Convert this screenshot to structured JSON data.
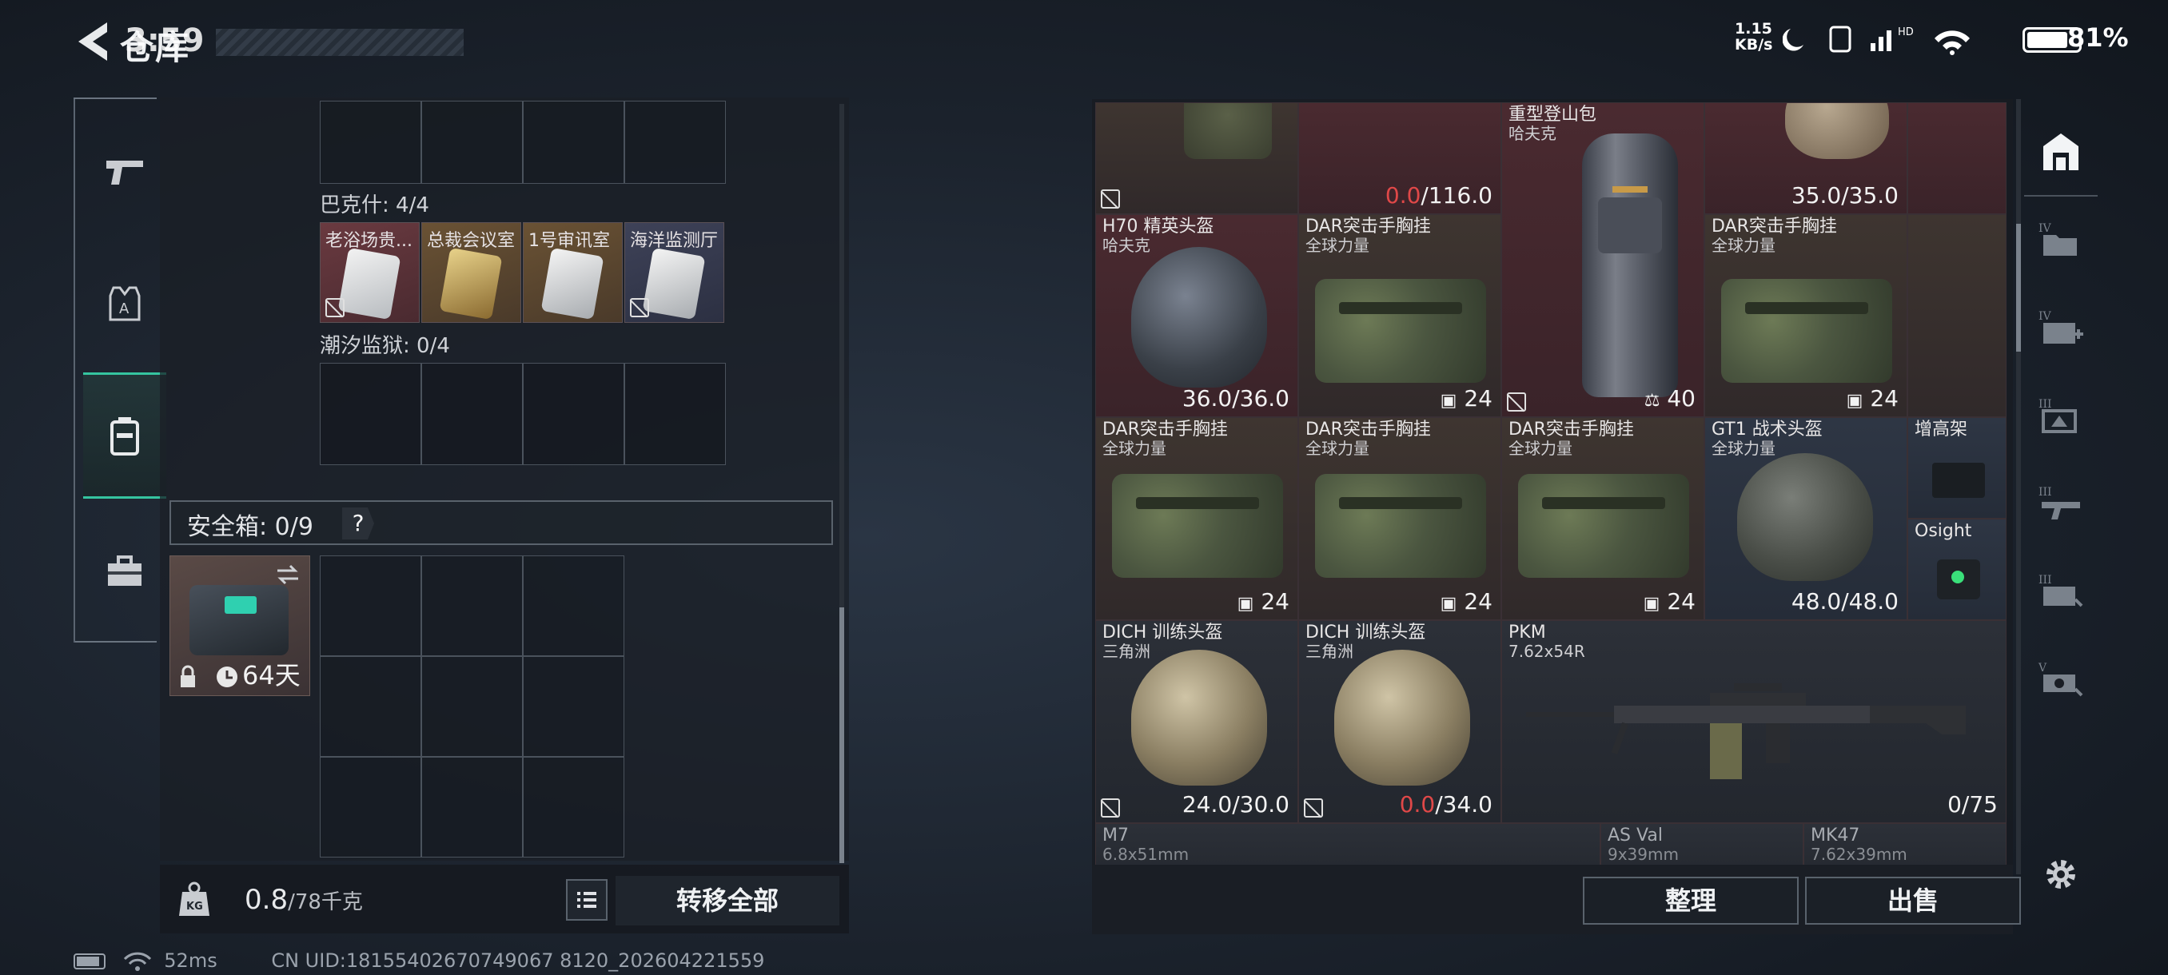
{
  "status": {
    "clock": "3:59",
    "net_speed": "1.15\nKB/s",
    "battery_text": "81%",
    "battery_level": 0.81
  },
  "header": {
    "title": "仓库"
  },
  "left_nav": {
    "items": [
      {
        "icon": "gun-icon"
      },
      {
        "icon": "armor-icon"
      },
      {
        "icon": "backpack-icon",
        "active": true
      },
      {
        "icon": "toolbox-icon"
      }
    ]
  },
  "keychain": {
    "bakshi_label": "巴克什: 4/4",
    "keys": [
      {
        "name": "老浴场贵..."
      },
      {
        "name": "总裁会议室"
      },
      {
        "name": "1号审讯室"
      },
      {
        "name": "海洋监测厅"
      }
    ],
    "tide_label": "潮汐监狱: 0/4"
  },
  "safe_box": {
    "label": "安全箱: 0/9",
    "help": "?",
    "item_time": "64天"
  },
  "bottom_left": {
    "weight": "0.8",
    "weight_max": "/78千克",
    "transfer_all": "转移全部"
  },
  "footer": {
    "ping": "52ms",
    "uid": "CN UID:18155402670749067 8120_202604221559"
  },
  "inventory": {
    "row0": [
      {
        "name": "",
        "value": ""
      },
      {
        "name": "",
        "value_red": "0.0",
        "value": "/116.0"
      },
      {
        "name": "重型登山包",
        "sub": "哈夫克",
        "value": "40"
      },
      {
        "name": "",
        "value": "35.0/35.0"
      }
    ],
    "row1": [
      {
        "name": "H70 精英头盔",
        "sub": "哈夫克",
        "value": "36.0/36.0"
      },
      {
        "name": "DAR突击手胸挂",
        "sub": "全球力量",
        "value": "24"
      },
      {
        "name": "DAR突击手胸挂",
        "sub": "全球力量",
        "value": "24"
      }
    ],
    "row2": [
      {
        "name": "DAR突击手胸挂",
        "sub": "全球力量",
        "value": "24"
      },
      {
        "name": "DAR突击手胸挂",
        "sub": "全球力量",
        "value": "24"
      },
      {
        "name": "DAR突击手胸挂",
        "sub": "全球力量",
        "value": "24"
      },
      {
        "name": "GT1 战术头盔",
        "sub": "全球力量",
        "value": "48.0/48.0"
      },
      {
        "name": "增高架"
      },
      {
        "name": "Osight"
      }
    ],
    "row3": [
      {
        "name": "DICH 训练头盔",
        "sub": "三角洲",
        "value": "24.0/30.0"
      },
      {
        "name": "DICH 训练头盔",
        "sub": "三角洲",
        "value_red": "0.0",
        "value": "/34.0"
      },
      {
        "name": "PKM",
        "sub": "7.62x54R",
        "value": "0/75"
      }
    ],
    "row4": [
      {
        "name": "M7",
        "sub": "6.8x51mm"
      },
      {
        "name": "AS Val",
        "sub": "9x39mm"
      },
      {
        "name": "MK47",
        "sub": "7.62x39mm"
      }
    ]
  },
  "actions": {
    "sort": "整理",
    "sell": "出售"
  },
  "right_nav": {
    "items": [
      {
        "icon": "storage-icon"
      },
      {
        "icon": "folder-iv-icon"
      },
      {
        "icon": "medkit-iv-icon"
      },
      {
        "icon": "ammo-iii-icon"
      },
      {
        "icon": "gun-iii-icon"
      },
      {
        "icon": "gun-iii-b-icon"
      },
      {
        "icon": "vehicle-v-icon"
      },
      {
        "icon": "gear-icon"
      }
    ]
  }
}
